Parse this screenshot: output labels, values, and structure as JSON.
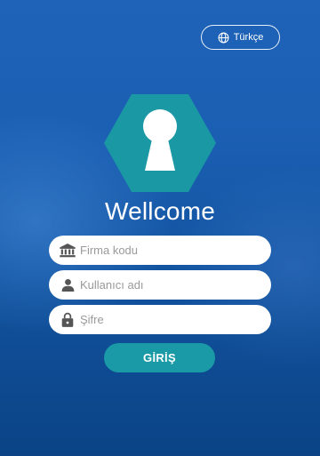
{
  "language_button": {
    "label": "Türkçe",
    "icon": "globe-icon"
  },
  "logo": {
    "icon": "keyhole-icon",
    "hexagon_color": "#1a98a4"
  },
  "title": "Wellcome",
  "form": {
    "company_code": {
      "placeholder": "Firma kodu",
      "icon": "bank-icon"
    },
    "username": {
      "placeholder": "Kullanıcı adı",
      "icon": "person-icon"
    },
    "password": {
      "placeholder": "Şifre",
      "icon": "lock-icon"
    }
  },
  "login_button": {
    "label": "GİRİŞ",
    "color": "#1a9aa6"
  }
}
